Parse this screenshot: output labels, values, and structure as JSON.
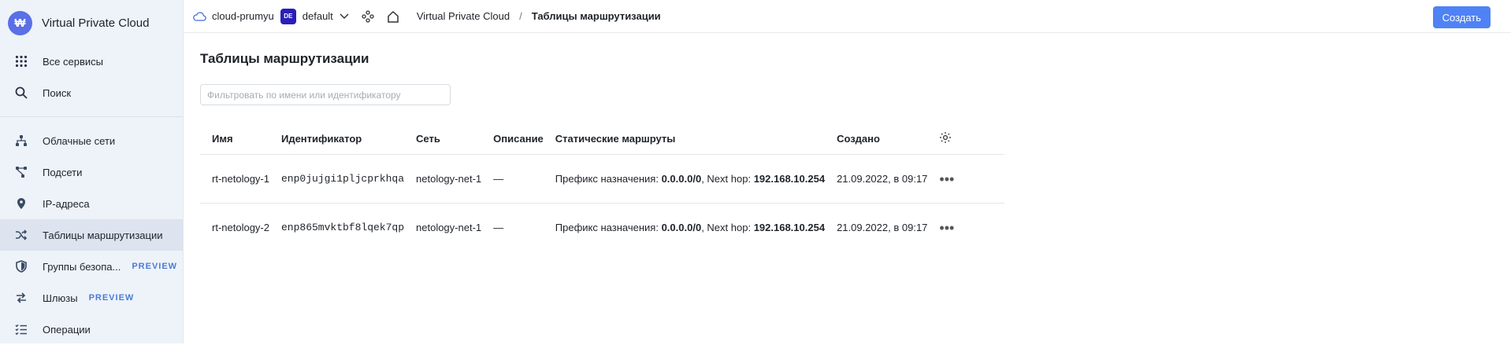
{
  "sidebar": {
    "app_title": "Virtual Private Cloud",
    "logo_glyph": "₩",
    "top_items": [
      {
        "label": "Все сервисы",
        "icon": "grid-icon"
      },
      {
        "label": "Поиск",
        "icon": "search-icon"
      }
    ],
    "items": [
      {
        "label": "Облачные сети",
        "icon": "network-icon",
        "badge": ""
      },
      {
        "label": "Подсети",
        "icon": "subnet-icon",
        "badge": ""
      },
      {
        "label": "IP-адреса",
        "icon": "location-pin-icon",
        "badge": ""
      },
      {
        "label": "Таблицы маршрутизации",
        "icon": "shuffle-icon",
        "badge": "",
        "active": true
      },
      {
        "label": "Группы безопа...",
        "icon": "shield-icon",
        "badge": "PREVIEW"
      },
      {
        "label": "Шлюзы",
        "icon": "gateway-icon",
        "badge": "PREVIEW"
      },
      {
        "label": "Операции",
        "icon": "list-check-icon",
        "badge": ""
      }
    ]
  },
  "topbar": {
    "cloud_name": "cloud-prumyu",
    "folder_badge": "DE",
    "folder_name": "default",
    "breadcrumb_service": "Virtual Private Cloud",
    "breadcrumb_separator": "/",
    "breadcrumb_current": "Таблицы маршрутизации",
    "create_label": "Создать"
  },
  "main": {
    "title": "Таблицы маршрутизации",
    "filter_placeholder": "Фильтровать по имени или идентификатору",
    "filter_value": "",
    "columns": {
      "name": "Имя",
      "id": "Идентификатор",
      "network": "Сеть",
      "description": "Описание",
      "routes": "Статические маршруты",
      "created": "Создано"
    },
    "rows": [
      {
        "name": "rt-netology-1",
        "id": "enp0jujgi1pljcprkhqa",
        "network": "netology-net-1",
        "description": "—",
        "route_prefix_label": "Префикс назначения:",
        "route_prefix": "0.0.0.0/0",
        "route_hop_label": ", Next hop:",
        "route_hop": "192.168.10.254",
        "created": "21.09.2022, в 09:17"
      },
      {
        "name": "rt-netology-2",
        "id": "enp865mvktbf8lqek7qp",
        "network": "netology-net-1",
        "description": "—",
        "route_prefix_label": "Префикс назначения:",
        "route_prefix": "0.0.0.0/0",
        "route_hop_label": ", Next hop:",
        "route_hop": "192.168.10.254",
        "created": "21.09.2022, в 09:17"
      }
    ]
  },
  "colors": {
    "accent": "#4f82f5",
    "link": "#3f6fd1",
    "sidebar_bg": "#eef2f9",
    "badge_preview": "#4a7cd6",
    "folder_badge_bg": "#2a1fb8"
  }
}
